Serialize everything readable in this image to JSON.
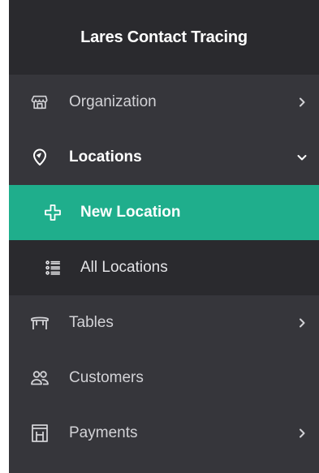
{
  "brand": {
    "title": "Lares Contact Tracing"
  },
  "menu": {
    "organization": {
      "label": "Organization",
      "icon": "store-icon"
    },
    "locations": {
      "label": "Locations",
      "icon": "map-pin-icon",
      "expanded": true
    },
    "locations_sub": [
      {
        "label": "New Location",
        "icon": "plus-icon",
        "active": true
      },
      {
        "label": "All Locations",
        "icon": "list-icon",
        "active": false
      }
    ],
    "tables": {
      "label": "Tables",
      "icon": "table-icon"
    },
    "customers": {
      "label": "Customers",
      "icon": "users-icon"
    },
    "payments": {
      "label": "Payments",
      "icon": "invoice-icon"
    }
  },
  "colors": {
    "sidebar_bg": "#36363b",
    "header_bg": "#2a2a2e",
    "submenu_bg": "#2a2a2e",
    "active_bg": "#1fae8c",
    "text": "#d2d2d6",
    "text_active": "#ffffff"
  }
}
